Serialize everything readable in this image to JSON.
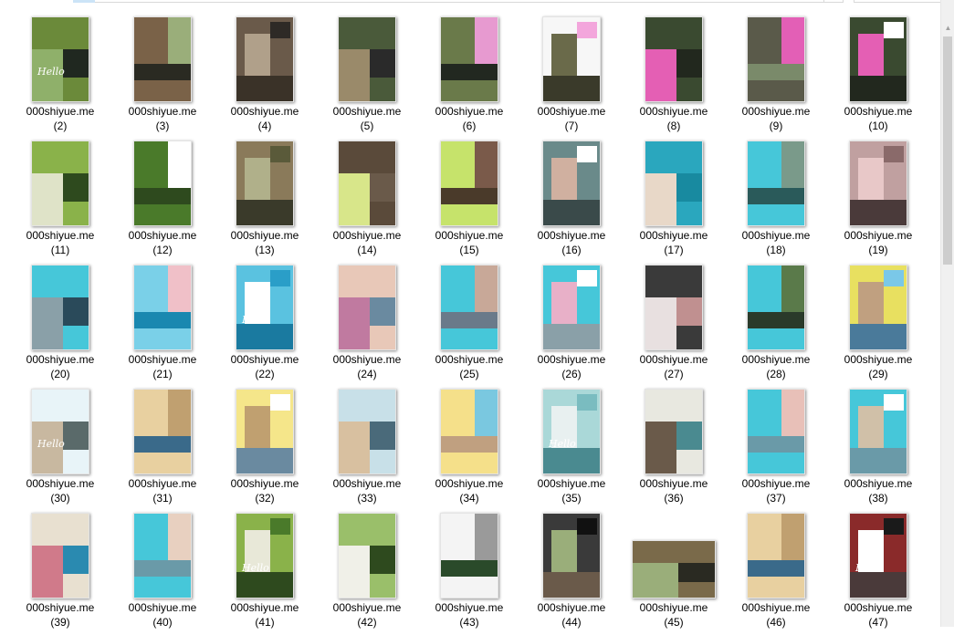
{
  "window": {
    "address_bar": "",
    "search_box": ""
  },
  "items": [
    {
      "name": "000shiyue.me",
      "num": "(2)",
      "palette": [
        "#3a4a2a",
        "#6b8a3a",
        "#8fb06a",
        "#202820"
      ],
      "overlay": "Hello"
    },
    {
      "name": "000shiyue.me",
      "num": "(3)",
      "palette": [
        "#4a3a2a",
        "#7a6248",
        "#9aae7a",
        "#2a2a22"
      ]
    },
    {
      "name": "000shiyue.me",
      "num": "(4)",
      "palette": [
        "#2e2a26",
        "#6a5a4a",
        "#b0a08a",
        "#3a3228"
      ]
    },
    {
      "name": "000shiyue.me",
      "num": "(5)",
      "palette": [
        "#f4f4f4",
        "#4a5a3a",
        "#9a8a6a",
        "#2a2a2a"
      ]
    },
    {
      "name": "000shiyue.me",
      "num": "(6)",
      "palette": [
        "#3c4a30",
        "#6a7a4a",
        "#e79ad0",
        "#222820"
      ]
    },
    {
      "name": "000shiyue.me",
      "num": "(7)",
      "palette": [
        "#f3a6dc",
        "#f7f7f7",
        "#6a6a4a",
        "#3a3a2a"
      ]
    },
    {
      "name": "000shiyue.me",
      "num": "(8)",
      "palette": [
        "#ffffff",
        "#3a4a30",
        "#e45fb4",
        "#22281e"
      ]
    },
    {
      "name": "000shiyue.me",
      "num": "(9)",
      "palette": [
        "#ffffff",
        "#5a5a4a",
        "#e35fb6",
        "#7a8a6a"
      ]
    },
    {
      "name": "000shiyue.me",
      "num": "(10)",
      "palette": [
        "#ffffff",
        "#3a4a30",
        "#e45fb4",
        "#22281e"
      ]
    },
    {
      "name": "000shiyue.me",
      "num": "(11)",
      "palette": [
        "#4a7a2a",
        "#8ab24a",
        "#dfe3c8",
        "#2e4a1e"
      ]
    },
    {
      "name": "000shiyue.me",
      "num": "(12)",
      "palette": [
        "#c8e36a",
        "#4a7a2a",
        "#ffffff",
        "#2e4a1e"
      ]
    },
    {
      "name": "000shiyue.me",
      "num": "(13)",
      "palette": [
        "#5a5a3a",
        "#8a7a5a",
        "#b0b08a",
        "#3a3a2a"
      ]
    },
    {
      "name": "000shiyue.me",
      "num": "(14)",
      "palette": [
        "#ffffff",
        "#5a4a3a",
        "#d8e68a",
        "#6a5a4a"
      ]
    },
    {
      "name": "000shiyue.me",
      "num": "(15)",
      "palette": [
        "#ffffff",
        "#c6e36b",
        "#7a5a4a",
        "#4a3a2a"
      ]
    },
    {
      "name": "000shiyue.me",
      "num": "(16)",
      "palette": [
        "#ffffff",
        "#6a8a8a",
        "#d0b0a0",
        "#3a4a4a"
      ]
    },
    {
      "name": "000shiyue.me",
      "num": "(17)",
      "palette": [
        "#5fc8d6",
        "#2aa7be",
        "#e8d8c8",
        "#188aa0"
      ]
    },
    {
      "name": "000shiyue.me",
      "num": "(18)",
      "palette": [
        "#ffffff",
        "#46c7d9",
        "#7a9a8a",
        "#2a5a5a"
      ]
    },
    {
      "name": "000shiyue.me",
      "num": "(19)",
      "palette": [
        "#8a6a6a",
        "#c0a0a0",
        "#e8c8c8",
        "#4a3a3a"
      ]
    },
    {
      "name": "000shiyue.me",
      "num": "(20)",
      "palette": [
        "#ffffff",
        "#46c7d9",
        "#8aa0a8",
        "#2a4a5a"
      ]
    },
    {
      "name": "000shiyue.me",
      "num": "(21)",
      "palette": [
        "#3fb4d8",
        "#7ad0e8",
        "#f0c0c8",
        "#1a88b0"
      ]
    },
    {
      "name": "000shiyue.me",
      "num": "(22)",
      "palette": [
        "#2a9ec8",
        "#5ac2e0",
        "#ffffff",
        "#1a7aa0"
      ],
      "overlay": "Hello"
    },
    {
      "name": "000shiyue.me",
      "num": "(24)",
      "palette": [
        "#ffffff",
        "#e8c8b8",
        "#c07aa0",
        "#6a8aa0"
      ]
    },
    {
      "name": "000shiyue.me",
      "num": "(25)",
      "palette": [
        "#ffffff",
        "#46c7d9",
        "#c8a898",
        "#6a7a8a"
      ]
    },
    {
      "name": "000shiyue.me",
      "num": "(26)",
      "palette": [
        "#ffffff",
        "#46c7d9",
        "#e8b0c8",
        "#8aa0a8"
      ]
    },
    {
      "name": "000shiyue.me",
      "num": "(27)",
      "palette": [
        "#ffffff",
        "#3a3a3a",
        "#e8e0e0",
        "#c09090"
      ]
    },
    {
      "name": "000shiyue.me",
      "num": "(28)",
      "palette": [
        "#ffffff",
        "#46c7d9",
        "#5a7a4a",
        "#2a3a2a"
      ]
    },
    {
      "name": "000shiyue.me",
      "num": "(29)",
      "palette": [
        "#7ac8e8",
        "#e8e060",
        "#c0a080",
        "#4a7a9a"
      ]
    },
    {
      "name": "000shiyue.me",
      "num": "(30)",
      "palette": [
        "#9ad8f0",
        "#e8f4f8",
        "#c8b8a0",
        "#5a6a6a"
      ],
      "overlay": "Hello"
    },
    {
      "name": "000shiyue.me",
      "num": "(31)",
      "palette": [
        "#6ac0e8",
        "#e8d0a0",
        "#c0a070",
        "#3a6a8a"
      ]
    },
    {
      "name": "000shiyue.me",
      "num": "(32)",
      "palette": [
        "#ffffff",
        "#f5e68a",
        "#c0a070",
        "#6a8aa0"
      ]
    },
    {
      "name": "000shiyue.me",
      "num": "(33)",
      "palette": [
        "#ffffff",
        "#c8e0e8",
        "#d8c0a0",
        "#4a6a7a"
      ]
    },
    {
      "name": "000shiyue.me",
      "num": "(34)",
      "palette": [
        "#ffffff",
        "#f5e08a",
        "#7ac8e0",
        "#c0a080"
      ]
    },
    {
      "name": "000shiyue.me",
      "num": "(35)",
      "palette": [
        "#7abcc0",
        "#aad8d8",
        "#e8f0f0",
        "#4a8a90"
      ],
      "overlay": "Hello"
    },
    {
      "name": "000shiyue.me",
      "num": "(36)",
      "palette": [
        "#9ad0d8",
        "#e8e8e0",
        "#6a5a4a",
        "#4a8a90"
      ]
    },
    {
      "name": "000shiyue.me",
      "num": "(37)",
      "palette": [
        "#ffffff",
        "#46c7d9",
        "#e8c0b8",
        "#6a9aa8"
      ]
    },
    {
      "name": "000shiyue.me",
      "num": "(38)",
      "palette": [
        "#ffffff",
        "#46c7d9",
        "#d0c0a8",
        "#6a9aa8"
      ]
    },
    {
      "name": "000shiyue.me",
      "num": "(39)",
      "palette": [
        "#5ac0e8",
        "#e8e0d0",
        "#d07a8a",
        "#2a8ab0"
      ]
    },
    {
      "name": "000shiyue.me",
      "num": "(40)",
      "palette": [
        "#ffffff",
        "#46c7d9",
        "#e8d0c0",
        "#6a9aa8"
      ]
    },
    {
      "name": "000shiyue.me",
      "num": "(41)",
      "palette": [
        "#4a7a2a",
        "#8ab24a",
        "#e8e8d8",
        "#2e4a1e"
      ],
      "overlay": "Hello"
    },
    {
      "name": "000shiyue.me",
      "num": "(42)",
      "palette": [
        "#5a8a3a",
        "#9abf6a",
        "#f0f0e8",
        "#2e4a1e"
      ]
    },
    {
      "name": "000shiyue.me",
      "num": "(43)",
      "palette": [
        "#ffffff",
        "#f4f4f4",
        "#9a9a9a",
        "#2a4a2a"
      ]
    },
    {
      "name": "000shiyue.me",
      "num": "(44)",
      "palette": [
        "#111111",
        "#3a3a3a",
        "#9aae7a",
        "#6a5a4a"
      ]
    },
    {
      "name": "000shiyue.me",
      "num": "(45)",
      "palette": [
        "#4a4a3a",
        "#7a6a4a",
        "#9aae7a",
        "#2a2a22"
      ],
      "landscape": true
    },
    {
      "name": "000shiyue.me",
      "num": "(46)",
      "palette": [
        "#6ac0e8",
        "#e8d0a0",
        "#c0a070",
        "#3a6a8a"
      ]
    },
    {
      "name": "000shiyue.me",
      "num": "(47)",
      "palette": [
        "#1a1a1a",
        "#8a2a2a",
        "#ffffff",
        "#4a3a3a"
      ],
      "overlay": "Hello"
    }
  ]
}
